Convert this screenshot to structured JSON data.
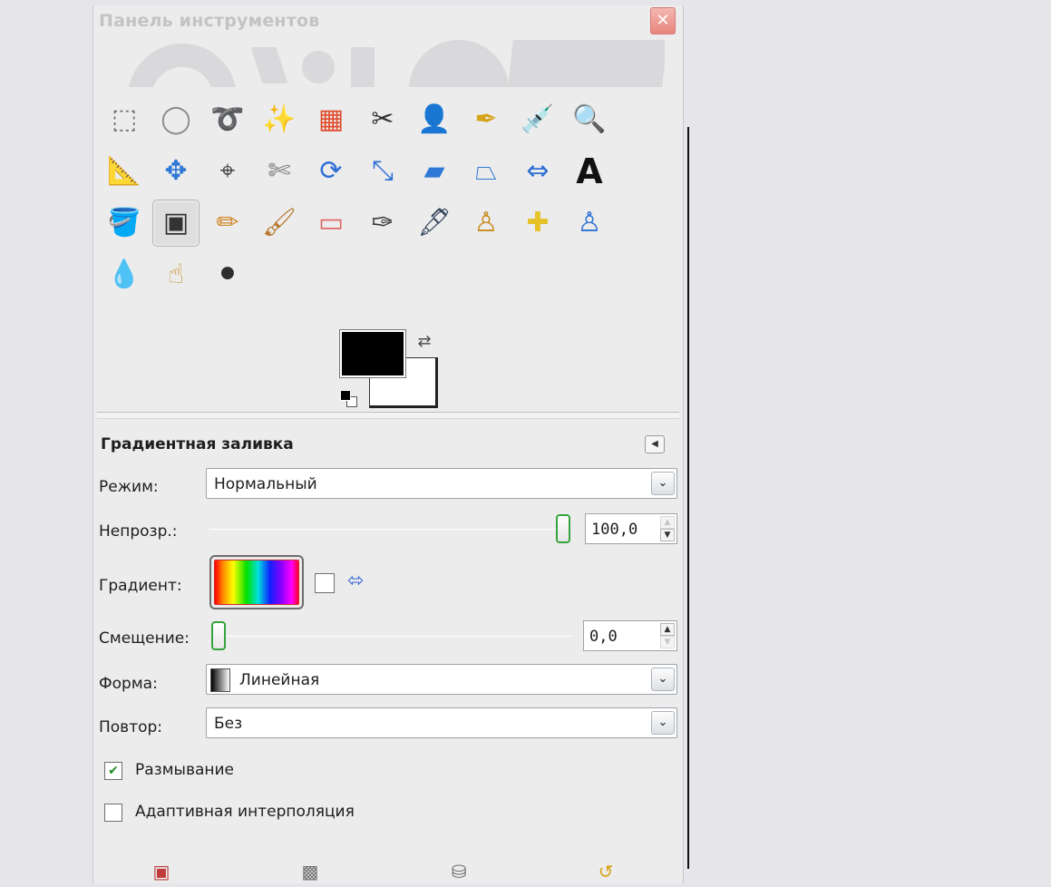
{
  "window": {
    "title": "Панель инструментов",
    "close_glyph": "✕"
  },
  "tools": {
    "row1": [
      {
        "name": "rect-select-icon",
        "glyph": "⬚",
        "color": "#6b6b6b"
      },
      {
        "name": "ellipse-select-icon",
        "glyph": "◯",
        "color": "#8a8a8a"
      },
      {
        "name": "free-select-icon",
        "glyph": "➰",
        "color": "#8a8a8a"
      },
      {
        "name": "fuzzy-select-icon",
        "glyph": "✨",
        "color": "#c9a227"
      },
      {
        "name": "select-by-color-icon",
        "glyph": "▦",
        "color": "#e04a2a"
      },
      {
        "name": "scissors-select-icon",
        "glyph": "✂",
        "color": "#2d2d2d"
      },
      {
        "name": "foreground-select-icon",
        "glyph": "👤",
        "color": "#2f6fd6"
      },
      {
        "name": "paths-icon",
        "glyph": "✒",
        "color": "#d6a218"
      },
      {
        "name": "color-picker-icon",
        "glyph": "💉",
        "color": "#2d2d2d"
      },
      {
        "name": "zoom-icon",
        "glyph": "🔍",
        "color": "#6a8fb7"
      }
    ],
    "row2": [
      {
        "name": "measure-icon",
        "glyph": "📐",
        "color": "#444444"
      },
      {
        "name": "move-icon",
        "glyph": "✥",
        "color": "#2f78d6"
      },
      {
        "name": "align-icon",
        "glyph": "⌖",
        "color": "#444444"
      },
      {
        "name": "crop-icon",
        "glyph": "✄",
        "color": "#777777"
      },
      {
        "name": "rotate-icon",
        "glyph": "⟳",
        "color": "#2f6fd6"
      },
      {
        "name": "scale-icon",
        "glyph": "⤡",
        "color": "#2f6fd6"
      },
      {
        "name": "shear-icon",
        "glyph": "▰",
        "color": "#2f78d6"
      },
      {
        "name": "perspective-icon",
        "glyph": "⏢",
        "color": "#2f78d6"
      },
      {
        "name": "flip-icon",
        "glyph": "⇔",
        "color": "#2f6fd6"
      },
      {
        "name": "text-icon",
        "glyph": "A",
        "color": "#111111"
      }
    ],
    "row3": [
      {
        "name": "bucket-fill-icon",
        "glyph": "🪣",
        "color": "#666666"
      },
      {
        "name": "blend-icon",
        "glyph": "▣",
        "color": "#333333"
      },
      {
        "name": "pencil-icon",
        "glyph": "✏",
        "color": "#d0882a"
      },
      {
        "name": "paintbrush-icon",
        "glyph": "🖌",
        "color": "#b7742b"
      },
      {
        "name": "eraser-icon",
        "glyph": "▭",
        "color": "#e06a6a"
      },
      {
        "name": "airbrush-icon",
        "glyph": "✑",
        "color": "#333333"
      },
      {
        "name": "ink-icon",
        "glyph": "🖋",
        "color": "#34435a"
      },
      {
        "name": "clone-icon",
        "glyph": "♙",
        "color": "#c98a1d"
      },
      {
        "name": "heal-icon",
        "glyph": "✚",
        "color": "#e6c12a"
      },
      {
        "name": "perspective-clone-icon",
        "glyph": "♙",
        "color": "#2f6fd6"
      }
    ],
    "row4": [
      {
        "name": "blur-sharpen-icon",
        "glyph": "💧",
        "color": "#3c86d6"
      },
      {
        "name": "smudge-icon",
        "glyph": "☝",
        "color": "#c99a3a"
      },
      {
        "name": "dodge-burn-icon",
        "glyph": "⚫",
        "color": "#2e2e2e"
      }
    ]
  },
  "colors": {
    "foreground": "#000000",
    "background": "#ffffff",
    "swap_glyph": "⇄"
  },
  "options": {
    "title": "Градиентная заливка",
    "config_glyph": "◀",
    "mode": {
      "label": "Режим:",
      "value": "Нормальный",
      "arrow": "⌄"
    },
    "opacity": {
      "label": "Непрозр.:",
      "value": "100,0",
      "fraction": 1.0,
      "up": "▲",
      "down": "▼"
    },
    "gradient": {
      "label": "Градиент:",
      "reverse_glyph": "⬄"
    },
    "offset": {
      "label": "Смещение:",
      "value": "0,0",
      "fraction": 0.0,
      "up": "▲",
      "down": "▼"
    },
    "shape": {
      "label": "Форма:",
      "value": "Линейная",
      "arrow": "⌄"
    },
    "repeat": {
      "label": "Повтор:",
      "value": "Без",
      "arrow": "⌄"
    },
    "dithering": {
      "label": "Размывание",
      "checked": true,
      "check_glyph": "✔"
    },
    "adaptive": {
      "label": "Адаптивная интерполяция",
      "checked": false
    }
  },
  "footer": [
    {
      "name": "save-options-icon",
      "glyph": "▣",
      "color": "#c23b3b"
    },
    {
      "name": "restore-options-icon",
      "glyph": "▩",
      "color": "#6f6f6f"
    },
    {
      "name": "delete-options-icon",
      "glyph": "⛁",
      "color": "#6a6a6a"
    },
    {
      "name": "reset-options-icon",
      "glyph": "↺",
      "color": "#d6a218"
    }
  ]
}
